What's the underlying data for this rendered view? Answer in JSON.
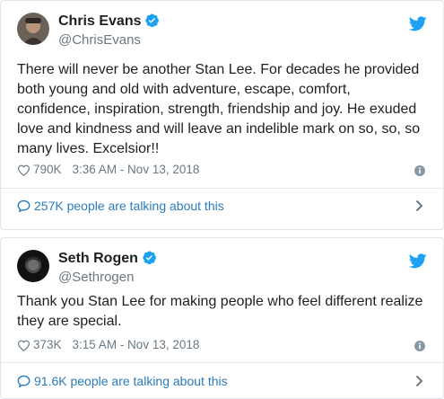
{
  "colors": {
    "twitter_blue": "#1da1f2",
    "link_blue": "#2b7bb9",
    "muted_gray": "#697882",
    "border": "#e1e8ed"
  },
  "icons": {
    "verified": "verified-badge-icon",
    "bird": "twitter-bird-icon",
    "like": "heart-icon",
    "info": "info-icon",
    "talk": "speech-bubble-icon",
    "more": "chevron-right-icon"
  },
  "tweets": [
    {
      "name": "Chris Evans",
      "handle": "@ChrisEvans",
      "text": "There will never be another Stan Lee. For decades he provided\nboth young and old with adventure, escape, comfort,\nconfidence, inspiration, strength, friendship and joy. He exuded\nlove and kindness and will leave an indelible mark on so, so, so\nmany lives. Excelsior!!",
      "likes": "790K",
      "timestamp": "3:36 AM - Nov 13, 2018",
      "talking": "257K people are talking about this"
    },
    {
      "name": "Seth Rogen",
      "handle": "@Sethrogen",
      "text": "Thank you Stan Lee for making people who feel different realize\nthey are special.",
      "likes": "373K",
      "timestamp": "3:15 AM - Nov 13, 2018",
      "talking": "91.6K people are talking about this"
    }
  ]
}
